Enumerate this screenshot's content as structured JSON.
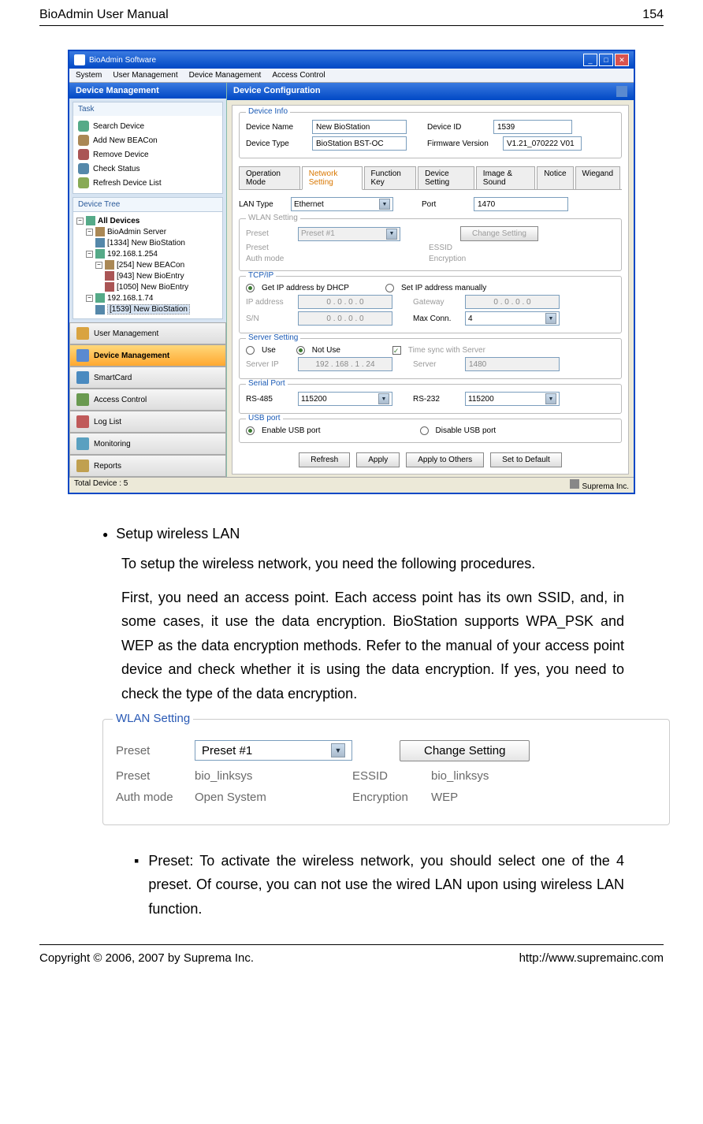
{
  "header": {
    "left": "BioAdmin User Manual",
    "right": "154"
  },
  "footer": {
    "left": "Copyright © 2006, 2007 by Suprema Inc.",
    "right": "http://www.supremainc.com"
  },
  "app": {
    "title": "BioAdmin Software",
    "menus": [
      "System",
      "User Management",
      "Device Management",
      "Access Control"
    ],
    "sidebar": {
      "title": "Device Management",
      "task_title": "Task",
      "tasks": [
        "Search Device",
        "Add New BEACon",
        "Remove Device",
        "Check Status",
        "Refresh Device List"
      ],
      "tree_title": "Device Tree",
      "tree": {
        "root": "All Devices",
        "n1": "BioAdmin Server",
        "n1a": "[1334] New BioStation",
        "n2": "192.168.1.254",
        "n2a": "[254] New BEACon",
        "n2a1": "[943] New BioEntry",
        "n2a2": "[1050] New BioEntry",
        "n3": "192.168.1.74",
        "n3a": "[1539] New BioStation"
      },
      "nav": [
        "User Management",
        "Device Management",
        "SmartCard",
        "Access Control",
        "Log List",
        "Monitoring",
        "Reports"
      ]
    },
    "main": {
      "title": "Device Configuration",
      "device_info": {
        "title": "Device Info",
        "name_label": "Device Name",
        "name_value": "New BioStation",
        "id_label": "Device ID",
        "id_value": "1539",
        "type_label": "Device Type",
        "type_value": "BioStation BST-OC",
        "fw_label": "Firmware Version",
        "fw_value": "V1.21_070222 V01"
      },
      "tabs": [
        "Operation Mode",
        "Network Setting",
        "Function Key",
        "Device Setting",
        "Image & Sound",
        "Notice",
        "Wiegand"
      ],
      "lan": {
        "type_label": "LAN Type",
        "type_value": "Ethernet",
        "port_label": "Port",
        "port_value": "1470"
      },
      "wlan": {
        "title": "WLAN Setting",
        "preset_label": "Preset",
        "preset_value": "Preset #1",
        "change_btn": "Change Setting",
        "preset2_label": "Preset",
        "essid_label": "ESSID",
        "auth_label": "Auth mode",
        "enc_label": "Encryption"
      },
      "tcpip": {
        "title": "TCP/IP",
        "dhcp": "Get IP address by DHCP",
        "manual": "Set IP address manually",
        "ip_label": "IP address",
        "ip_value": "0 . 0 . 0 . 0",
        "gw_label": "Gateway",
        "gw_value": "0 . 0 . 0 . 0",
        "sn_label": "S/N",
        "sn_value": "0 . 0 . 0 . 0",
        "max_label": "Max Conn.",
        "max_value": "4"
      },
      "server": {
        "title": "Server Setting",
        "use": "Use",
        "notuse": "Not Use",
        "sync": "Time sync with Server",
        "ip_label": "Server IP",
        "ip_value": "192 . 168 . 1 . 24",
        "port_label": "Server",
        "port_value": "1480"
      },
      "serial": {
        "title": "Serial Port",
        "rs485_label": "RS-485",
        "rs485_value": "115200",
        "rs232_label": "RS-232",
        "rs232_value": "115200"
      },
      "usb": {
        "title": "USB port",
        "enable": "Enable USB port",
        "disable": "Disable USB port"
      },
      "buttons": [
        "Refresh",
        "Apply",
        "Apply to Others",
        "Set to Default"
      ]
    },
    "status": {
      "left": "Total Device : 5",
      "right": "Suprema Inc."
    }
  },
  "doc": {
    "bullet_heading": "Setup wireless LAN",
    "para1": "To setup the wireless network, you need the following procedures.",
    "para2": "First, you need an access point. Each access point has its own SSID, and, in some cases, it use the data encryption. BioStation supports WPA_PSK and WEP as the data encryption methods. Refer to the manual of your access point device and check whether it is using the data encryption. If yes, you need to check the type of the data encryption.",
    "wlan_detail": {
      "title": "WLAN Setting",
      "preset_label": "Preset",
      "preset_select": "Preset #1",
      "change_btn": "Change Setting",
      "preset_name_label": "Preset",
      "preset_name_value": "bio_linksys",
      "essid_label": "ESSID",
      "essid_value": "bio_linksys",
      "auth_label": "Auth mode",
      "auth_value": "Open System",
      "enc_label": "Encryption",
      "enc_value": "WEP"
    },
    "sub_bullet": "Preset: To activate the wireless network, you should select one of the 4 preset. Of course, you can not use the wired LAN upon using wireless LAN function."
  }
}
